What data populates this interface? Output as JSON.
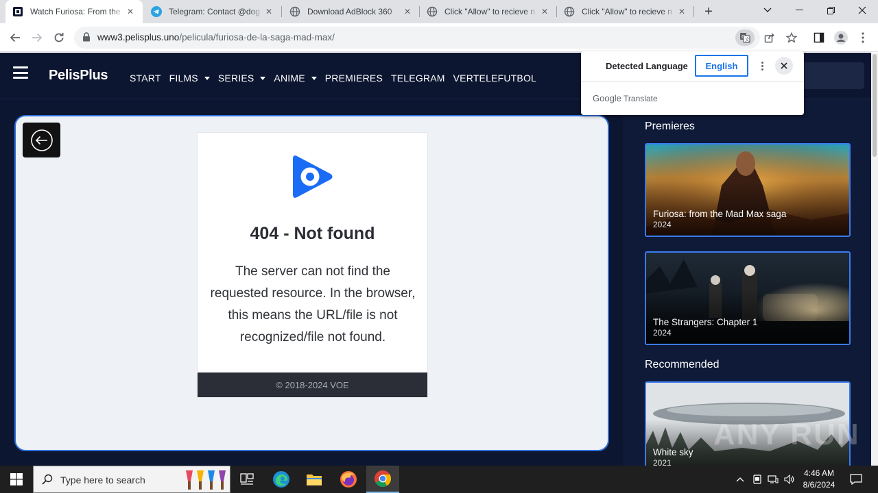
{
  "browser": {
    "tabs": [
      {
        "title": "Watch Furiosa: From the",
        "favicon": "pelisplus-favicon",
        "active": true
      },
      {
        "title": "Telegram: Contact @dog",
        "favicon": "telegram-favicon",
        "active": false
      },
      {
        "title": "Download AdBlock 360",
        "favicon": "globe-favicon",
        "active": false
      },
      {
        "title": "Click \"Allow\" to recieve n",
        "favicon": "globe-favicon",
        "active": false
      },
      {
        "title": "Click \"Allow\" to recieve n",
        "favicon": "globe-favicon",
        "active": false
      }
    ],
    "url_host": "www3.pelisplus.uno",
    "url_path": "/pelicula/furiosa-de-la-saga-mad-max/"
  },
  "translate_popup": {
    "detected_label": "Detected Language",
    "target_label": "English",
    "brand_google": "Google",
    "brand_translate": "Translate"
  },
  "site": {
    "logo": "PelisPlus",
    "nav": [
      {
        "label": "START",
        "dropdown": false
      },
      {
        "label": "FILMS",
        "dropdown": true
      },
      {
        "label": "SERIES",
        "dropdown": true
      },
      {
        "label": "ANIME",
        "dropdown": true
      },
      {
        "label": "PREMIERES",
        "dropdown": false
      },
      {
        "label": "TELEGRAM",
        "dropdown": false
      },
      {
        "label": "VERTELEFUTBOL",
        "dropdown": false
      }
    ]
  },
  "player": {
    "error_title": "404 - Not found",
    "error_message": "The server can not find the requested resource. In the browser, this means the URL/file is not recognized/file not found.",
    "footer": "© 2018-2024 VOE"
  },
  "sidebar": {
    "premieres_title": "Premieres",
    "recommended_title": "Recommended",
    "premieres": [
      {
        "title": "Furiosa: from the Mad Max saga",
        "year": "2024"
      },
      {
        "title": "The Strangers: Chapter 1",
        "year": "2024"
      }
    ],
    "recommended": [
      {
        "title": "White sky",
        "year": "2021"
      }
    ]
  },
  "watermark": "ANY RUN",
  "taskbar": {
    "search_placeholder": "Type here to search",
    "time": "4:46 AM",
    "date": "8/6/2024"
  },
  "colors": {
    "page_bg": "#0c1631",
    "accent_blue": "#2f6fdb",
    "card_border": "#3b7af0",
    "voe_blue": "#1a6cf5"
  }
}
